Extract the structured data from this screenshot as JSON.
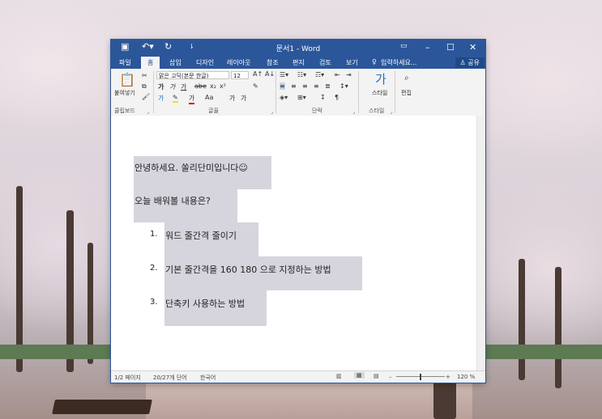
{
  "window": {
    "title": "문서1 - Word"
  },
  "tabs": [
    {
      "label": "파일"
    },
    {
      "label": "홈"
    },
    {
      "label": "삽입"
    },
    {
      "label": "디자인"
    },
    {
      "label": "레이아웃"
    },
    {
      "label": "참조"
    },
    {
      "label": "편지"
    },
    {
      "label": "검토"
    },
    {
      "label": "보기"
    }
  ],
  "tell_me": "입력하세요...",
  "share": "공유",
  "ribbon": {
    "paste_label": "붙여넣기",
    "font_name": "맑은 고딕(본문 한글)",
    "font_size": "12",
    "style_label": "스타일",
    "edit_label": "편집",
    "groups": {
      "clipboard": "클립보드",
      "font": "글꼴",
      "paragraph": "단락",
      "styles": "스타일"
    }
  },
  "document": {
    "lines": [
      "안녕하세요. 쏠리단미입니다☺",
      "오늘 배워볼 내용은?"
    ],
    "list": [
      {
        "num": "1.",
        "text": "워드 줄간격 줄이기"
      },
      {
        "num": "2.",
        "text": "기본 줄간격을 160 180 으로 지정하는 방법"
      },
      {
        "num": "3.",
        "text": "단축키 사용하는 방법"
      }
    ]
  },
  "status": {
    "page": "1/2 페이지",
    "words": "20/27개 단어",
    "language": "한국어",
    "zoom": "120 %"
  }
}
